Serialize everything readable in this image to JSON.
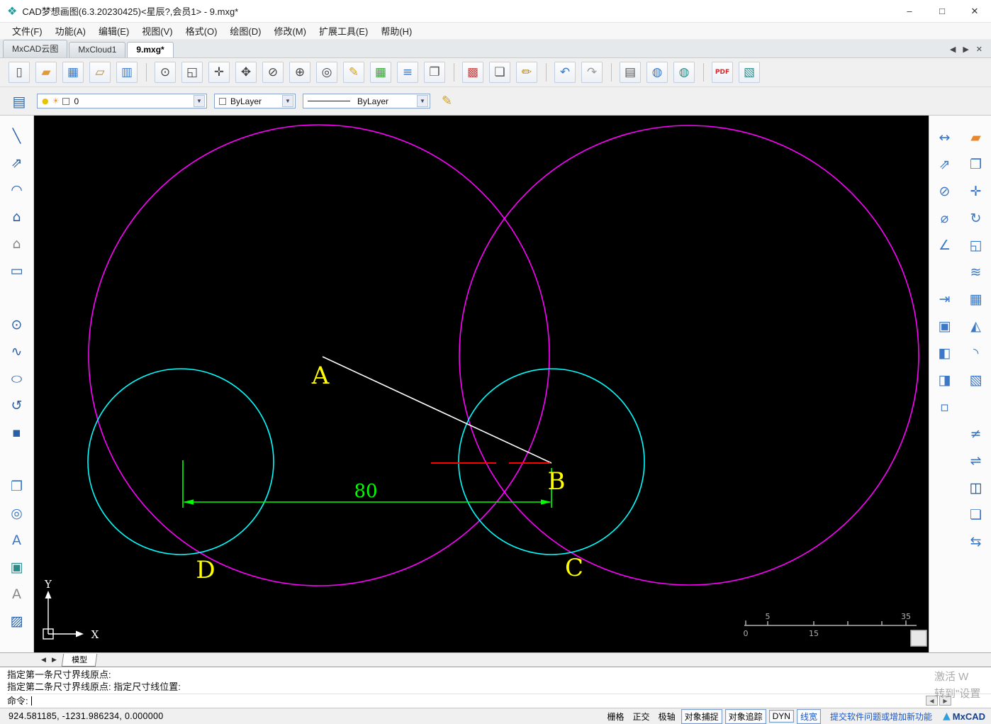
{
  "window": {
    "title": "CAD梦想画图(6.3.20230425)<星辰?,会员1> - 9.mxg*",
    "controls": {
      "minimize": "–",
      "maximize": "□",
      "close": "✕"
    }
  },
  "menu": {
    "items": [
      {
        "label": "文件(F)"
      },
      {
        "label": "功能(A)"
      },
      {
        "label": "编辑(E)"
      },
      {
        "label": "视图(V)"
      },
      {
        "label": "格式(O)"
      },
      {
        "label": "绘图(D)"
      },
      {
        "label": "修改(M)"
      },
      {
        "label": "扩展工具(E)"
      },
      {
        "label": "帮助(H)"
      }
    ]
  },
  "doc_tabs": {
    "items": [
      {
        "label": "MxCAD云图",
        "cls": ""
      },
      {
        "label": "MxCloud1",
        "cls": ""
      },
      {
        "label": "9.mxg*",
        "cls": "active"
      }
    ],
    "nav": {
      "prev": "◀",
      "next": "▶",
      "close": "✕"
    }
  },
  "toolbar_main": {
    "icons": [
      {
        "name": "new-file-icon",
        "glyph": "▯",
        "color": "#555",
        "cls": ""
      },
      {
        "name": "open-folder-icon",
        "glyph": "▰",
        "color": "#e09a3c",
        "cls": ""
      },
      {
        "name": "save-icon",
        "glyph": "▦",
        "color": "#3c78c8",
        "cls": ""
      },
      {
        "name": "open-file-icon",
        "glyph": "▱",
        "color": "#b08840",
        "cls": ""
      },
      {
        "name": "save-as-icon",
        "glyph": "▥",
        "color": "#3c78c8",
        "cls": "sep-after"
      },
      {
        "name": "zoom-previous-icon",
        "glyph": "⊙",
        "color": "#444",
        "cls": ""
      },
      {
        "name": "zoom-window-icon",
        "glyph": "◱",
        "color": "#444",
        "cls": ""
      },
      {
        "name": "zoom-extents-icon",
        "glyph": "✛",
        "color": "#444",
        "cls": ""
      },
      {
        "name": "pan-icon",
        "glyph": "✥",
        "color": "#444",
        "cls": ""
      },
      {
        "name": "zoom-scale-icon",
        "glyph": "⊘",
        "color": "#444",
        "cls": ""
      },
      {
        "name": "zoom-realtime-icon",
        "glyph": "⊕",
        "color": "#444",
        "cls": ""
      },
      {
        "name": "find-icon",
        "glyph": "◎",
        "color": "#444",
        "cls": ""
      },
      {
        "name": "draw-pencil-icon",
        "glyph": "✎",
        "color": "#d4a017",
        "cls": ""
      },
      {
        "name": "table-icon",
        "glyph": "▦",
        "color": "#3a9e3a",
        "cls": ""
      },
      {
        "name": "mtext-icon",
        "glyph": "≡",
        "color": "#3c78c8",
        "cls": ""
      },
      {
        "name": "copy-layout-icon",
        "glyph": "❐",
        "color": "#555",
        "cls": "sep-after"
      },
      {
        "name": "palette-icon",
        "glyph": "▩",
        "color": "#c84848",
        "cls": ""
      },
      {
        "name": "export-page-icon",
        "glyph": "❏",
        "color": "#555",
        "cls": ""
      },
      {
        "name": "edit-page-icon",
        "glyph": "✏",
        "color": "#b8860b",
        "cls": "sep-after"
      },
      {
        "name": "undo-icon",
        "glyph": "↶",
        "color": "#3c78c8",
        "cls": ""
      },
      {
        "name": "redo-icon",
        "glyph": "↷",
        "color": "#9a9a9a",
        "cls": "sep-after"
      },
      {
        "name": "print-icon",
        "glyph": "▤",
        "color": "#555",
        "cls": ""
      },
      {
        "name": "web-icon",
        "glyph": "◍",
        "color": "#3c78c8",
        "cls": ""
      },
      {
        "name": "web-publish-icon",
        "glyph": "◍",
        "color": "#2b8a8a",
        "cls": "sep-after"
      },
      {
        "name": "pdf-export-icon",
        "glyph": "PDF",
        "color": "#d42a2a",
        "cls": "txt"
      },
      {
        "name": "image-export-icon",
        "glyph": "▧",
        "color": "#2b8a8a",
        "cls": ""
      }
    ]
  },
  "properties_bar": {
    "layer": {
      "value": "0",
      "bulb": "●",
      "sun": "☀"
    },
    "color": {
      "value": "ByLayer"
    },
    "linetype": {
      "value": "ByLayer"
    },
    "dropdown_glyph": "▼"
  },
  "left_toolbar": {
    "icons": [
      {
        "name": "line-icon",
        "glyph": "╲",
        "color": "#2b5fa5",
        "cls": ""
      },
      {
        "name": "construction-line-icon",
        "glyph": "⇗",
        "color": "#2b5fa5",
        "cls": ""
      },
      {
        "name": "arc-icon",
        "glyph": "◠",
        "color": "#2b5fa5",
        "cls": ""
      },
      {
        "name": "polygon-filled-icon",
        "glyph": "⌂",
        "color": "#2b5fa5",
        "cls": ""
      },
      {
        "name": "polygon-icon",
        "glyph": "⌂",
        "color": "#888",
        "cls": ""
      },
      {
        "name": "rectangle-icon",
        "glyph": "▭",
        "color": "#2b5fa5",
        "cls": "gap-after"
      },
      {
        "name": "circle-icon",
        "glyph": "⊙",
        "color": "#2b5fa5",
        "cls": ""
      },
      {
        "name": "spline-icon",
        "glyph": "∿",
        "color": "#2b5fa5",
        "cls": ""
      },
      {
        "name": "ellipse-icon",
        "glyph": "○",
        "color": "#2b5fa5",
        "cls": "squash"
      },
      {
        "name": "revcloud-icon",
        "glyph": "↺",
        "color": "#2b5fa5",
        "cls": ""
      },
      {
        "name": "point-icon",
        "glyph": "▪",
        "color": "#2b5fa5",
        "cls": "gap-after"
      },
      {
        "name": "clipboard-icon",
        "glyph": "❐",
        "color": "#3c78c8",
        "cls": ""
      },
      {
        "name": "donut-icon",
        "glyph": "◎",
        "color": "#3c78c8",
        "cls": ""
      },
      {
        "name": "text-icon",
        "glyph": "A",
        "color": "#3c78c8",
        "cls": ""
      },
      {
        "name": "image-insert-icon",
        "glyph": "▣",
        "color": "#2b8a8a",
        "cls": ""
      },
      {
        "name": "text-style-icon",
        "glyph": "A",
        "color": "#888",
        "cls": ""
      },
      {
        "name": "hatch-icon",
        "glyph": "▨",
        "color": "#2b5fa5",
        "cls": ""
      }
    ]
  },
  "right_toolbar": {
    "inner": [
      {
        "name": "dim-linear-icon",
        "glyph": "↔",
        "color": "#3c78c8",
        "cls": ""
      },
      {
        "name": "dim-aligned-icon",
        "glyph": "⇗",
        "color": "#3c78c8",
        "cls": ""
      },
      {
        "name": "dim-radius-icon",
        "glyph": "⊘",
        "color": "#3c78c8",
        "cls": ""
      },
      {
        "name": "dim-diameter-icon",
        "glyph": "⌀",
        "color": "#3c78c8",
        "cls": ""
      },
      {
        "name": "dim-angular-icon",
        "glyph": "∠",
        "color": "#3c78c8",
        "cls": "gap-after"
      },
      {
        "name": "dim-continue-icon",
        "glyph": "⇥",
        "color": "#3c78c8",
        "cls": ""
      },
      {
        "name": "block-create-icon",
        "glyph": "▣",
        "color": "#3c78c8",
        "cls": ""
      },
      {
        "name": "block-insert-icon",
        "glyph": "◧",
        "color": "#3c78c8",
        "cls": ""
      },
      {
        "name": "block-write-icon",
        "glyph": "◨",
        "color": "#3c78c8",
        "cls": ""
      },
      {
        "name": "block-attribute-icon",
        "glyph": "▫",
        "color": "#3c78c8",
        "cls": ""
      }
    ],
    "outer": [
      {
        "name": "erase-icon",
        "glyph": "▰",
        "color": "#e8872b",
        "cls": ""
      },
      {
        "name": "copy-icon",
        "glyph": "❐",
        "color": "#3c78c8",
        "cls": ""
      },
      {
        "name": "move-icon",
        "glyph": "✛",
        "color": "#3c78c8",
        "cls": ""
      },
      {
        "name": "rotate-icon",
        "glyph": "↻",
        "color": "#3c78c8",
        "cls": ""
      },
      {
        "name": "scale-icon",
        "glyph": "◱",
        "color": "#3c78c8",
        "cls": ""
      },
      {
        "name": "offset-icon",
        "glyph": "≋",
        "color": "#3c78c8",
        "cls": ""
      },
      {
        "name": "array-icon",
        "glyph": "▦",
        "color": "#3c78c8",
        "cls": ""
      },
      {
        "name": "mirror-icon",
        "glyph": "◭",
        "color": "#3c78c8",
        "cls": ""
      },
      {
        "name": "fillet-icon",
        "glyph": "◝",
        "color": "#3c78c8",
        "cls": ""
      },
      {
        "name": "trim-icon",
        "glyph": "▧",
        "color": "#3c78c8",
        "cls": "gap-after"
      },
      {
        "name": "break-icon",
        "glyph": "≠",
        "color": "#3c78c8",
        "cls": ""
      },
      {
        "name": "stretch-icon",
        "glyph": "⇌",
        "color": "#3c78c8",
        "cls": ""
      },
      {
        "name": "box3d-icon",
        "glyph": "◫",
        "color": "#26476e",
        "cls": ""
      },
      {
        "name": "sheet-icon",
        "glyph": "❏",
        "color": "#3c78c8",
        "cls": ""
      },
      {
        "name": "align-icon",
        "glyph": "⇆",
        "color": "#3c78c8",
        "cls": ""
      }
    ]
  },
  "canvas": {
    "colors": {
      "bg": "#000000",
      "circle-large": "#ff00ff",
      "circle-small": "#00ffff",
      "dim": "#00ff00",
      "label": "#ffff00",
      "line": "#ffffff",
      "redline": "#ff0000",
      "ruler": "#b0b0b0"
    },
    "labels": {
      "a": "A",
      "b": "B",
      "c": "C",
      "d": "D"
    },
    "dim_text": "80",
    "ucs": {
      "x": "X",
      "y": "Y"
    },
    "ruler": {
      "top_left": "5",
      "top_right": "35",
      "bottom_left": "0",
      "bottom_mid": "15"
    }
  },
  "model_bar": {
    "prev": "◀",
    "next": "▶",
    "tab": "模型"
  },
  "command": {
    "lines": [
      {
        "text": "指定第一条尺寸界线原点:"
      },
      {
        "text": "指定第二条尺寸界线原点:  指定尺寸线位置:"
      }
    ],
    "prompt": "命令:",
    "scroll_left": "◀",
    "scroll_right": "▶"
  },
  "watermark": {
    "line1": "激活 W",
    "line2": "转到\"设置"
  },
  "status": {
    "coordinates": "924.581185,  -1231.986234,  0.000000",
    "toggles": [
      {
        "label": "栅格",
        "cls": ""
      },
      {
        "label": "正交",
        "cls": ""
      },
      {
        "label": "极轴",
        "cls": ""
      },
      {
        "label": "对象捕捉",
        "cls": "boxed"
      },
      {
        "label": "对象追踪",
        "cls": "boxed"
      },
      {
        "label": "DYN",
        "cls": "boxed"
      },
      {
        "label": "线宽",
        "cls": "boxed blue"
      }
    ],
    "link": "提交软件问题或增加新功能",
    "brand": "MxCAD"
  }
}
